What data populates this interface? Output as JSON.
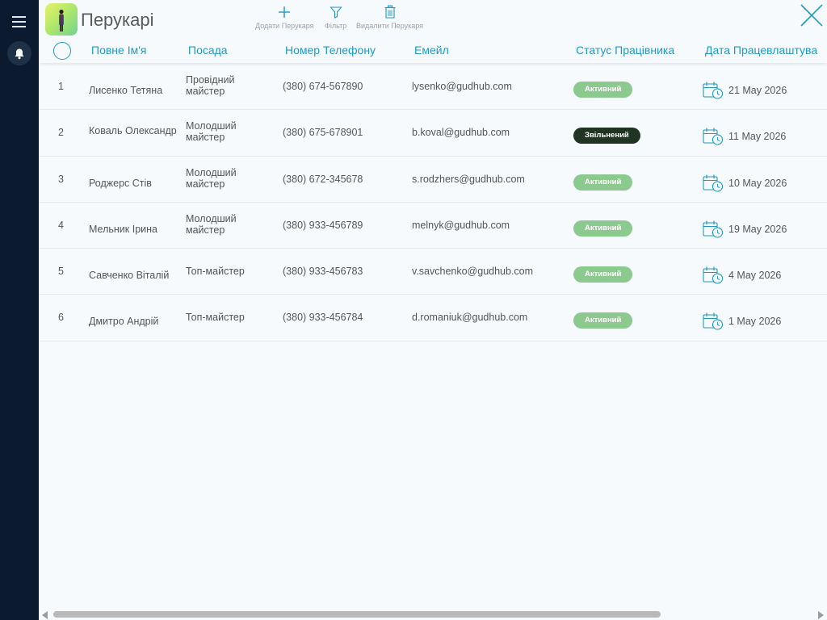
{
  "app": {
    "title": "Перукарі",
    "toolbar": {
      "add_label": "Додати Перукаря",
      "filter_label": "Фільтр",
      "delete_label": "Видалити Перукаря"
    }
  },
  "colors": {
    "accent": "#1e9ac4",
    "active_badge": "#8cc98f",
    "fired_badge": "#1f3522",
    "sidebar": "#0b1a2e"
  },
  "icons": {
    "menu": "hamburger-icon",
    "notifications": "bell-icon",
    "add": "plus-icon",
    "filter": "funnel-icon",
    "delete": "trash-icon",
    "close": "close-icon",
    "date": "calendar-clock-icon"
  },
  "table": {
    "columns": [
      "Повне Ім'я",
      "Посада",
      "Номер Телефону",
      "Емейл",
      "Статус Працівника",
      "Дата Працевлаштува"
    ],
    "rows": [
      {
        "num": "1",
        "name": "Лисенко Тетяна",
        "position": "Провідний майстер",
        "phone": "(380) 674-567890",
        "email": "lysenko@gudhub.com",
        "status": "Активний",
        "date": "21 May 2026"
      },
      {
        "num": "2",
        "name": "Коваль Олександр",
        "position": "Молодший майстер",
        "phone": "(380) 675-678901",
        "email": "b.koval@gudhub.com",
        "status": "Звільнений",
        "date": "11 May 2026"
      },
      {
        "num": "3",
        "name": "Роджерс Стів",
        "position": "Молодший майстер",
        "phone": "(380) 672-345678",
        "email": "s.rodzhers@gudhub.com",
        "status": "Активний",
        "date": "10 May 2026"
      },
      {
        "num": "4",
        "name": "Мельник Ірина",
        "position": "Молодший майстер",
        "phone": "(380) 933-456789",
        "email": "melnyk@gudhub.com",
        "status": "Активний",
        "date": "19 May 2026"
      },
      {
        "num": "5",
        "name": "Савченко Віталій",
        "position": "Топ-майстер",
        "phone": "(380) 933-456783",
        "email": "v.savchenko@gudhub.com",
        "status": "Активний",
        "date": "4 May 2026"
      },
      {
        "num": "6",
        "name": "Дмитро Андрій",
        "position": "Топ-майстер",
        "phone": "(380) 933-456784",
        "email": "d.romaniuk@gudhub.com",
        "status": "Активний",
        "date": "1 May 2026"
      }
    ]
  }
}
